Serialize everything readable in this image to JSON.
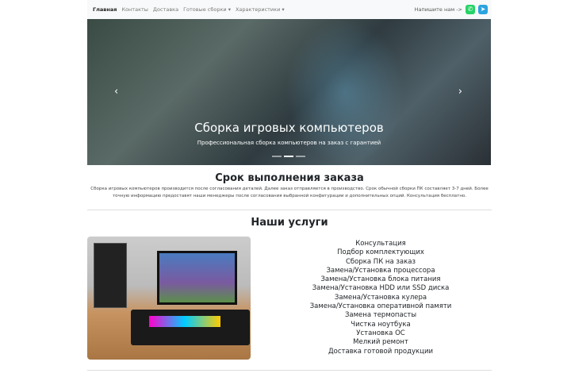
{
  "nav": {
    "items": [
      "Главная",
      "Контакты",
      "Доставка",
      "Готовые сборки ▾",
      "Характеристики ▾"
    ],
    "contact_label": "Напишите нам ->"
  },
  "hero": {
    "title": "Сборка игровых компьютеров",
    "subtitle": "Профессиональная сборка компьютеров на заказ с гарантией",
    "prev": "‹",
    "next": "›"
  },
  "order": {
    "title": "Срок выполнения заказа",
    "text": "Сборка игровых компьютеров производится после согласования деталей. Далее заказ отправляется в производство. Срок обычной сборки ПК составляет 3-7 дней. Более точную информацию предоставят наши менеджеры после согласования выбранной конфигурации и дополнительных опций. Консультация бесплатно."
  },
  "services": {
    "title": "Наши услуги",
    "items": [
      "Консультация",
      "Подбор комплектующих",
      "Сборка ПК на заказ",
      "Замена/Установка процессора",
      "Замена/Установка блока питания",
      "Замена/Установка HDD или SSD диска",
      "Замена/Установка кулера",
      "Замена/Установка оперативной памяти",
      "Замена термопасты",
      "Чистка ноутбука",
      "Установка ОС",
      "Мелкий ремонт",
      "Доставка готовой продукции"
    ]
  }
}
